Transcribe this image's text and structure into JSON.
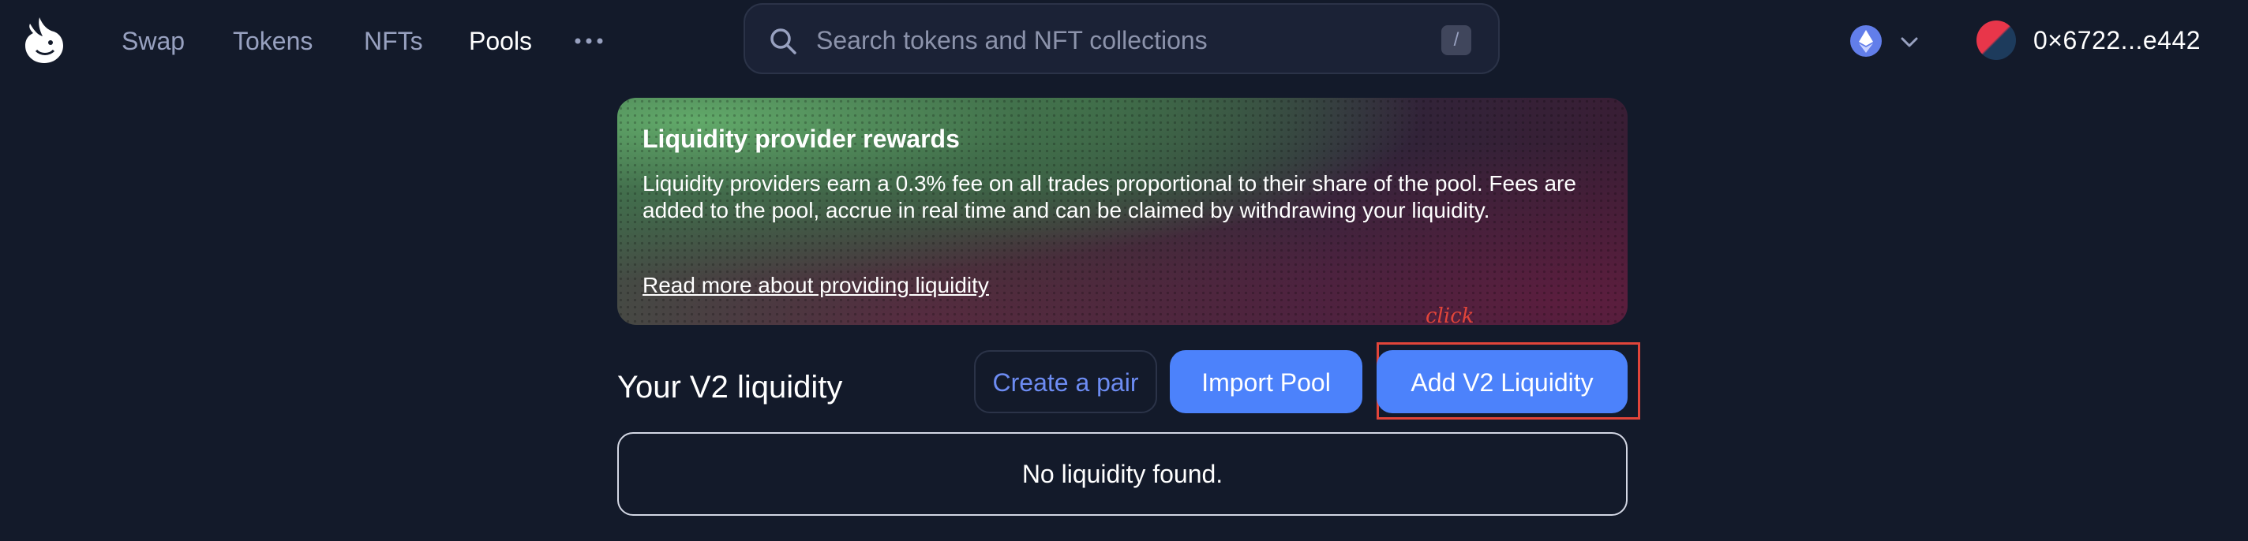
{
  "nav": {
    "items": [
      {
        "label": "Swap",
        "active": false
      },
      {
        "label": "Tokens",
        "active": false
      },
      {
        "label": "NFTs",
        "active": false
      },
      {
        "label": "Pools",
        "active": true
      }
    ],
    "more_icon": "ellipsis-icon"
  },
  "search": {
    "placeholder": "Search tokens and NFT collections",
    "shortcut": "/"
  },
  "network": {
    "icon": "ethereum-icon",
    "dropdown_icon": "chevron-down-icon"
  },
  "wallet": {
    "address": "0×6722...e442"
  },
  "banner": {
    "title": "Liquidity provider rewards",
    "body": "Liquidity providers earn a 0.3% fee on all trades proportional to their share of the pool. Fees are added to the pool, accrue in real time and can be claimed by withdrawing your liquidity.",
    "link": "Read more about providing liquidity"
  },
  "annotation": {
    "label": "click",
    "color": "#e2453a"
  },
  "v2": {
    "title": "Your V2 liquidity",
    "create_pair": "Create a pair",
    "import_pool": "Import Pool",
    "add_liquidity": "Add V2 Liquidity",
    "empty": "No liquidity found."
  },
  "colors": {
    "background": "#131a2a",
    "accent": "#4c82fb",
    "link_accent": "#6d8cf3",
    "muted_text": "#98a1c0"
  }
}
